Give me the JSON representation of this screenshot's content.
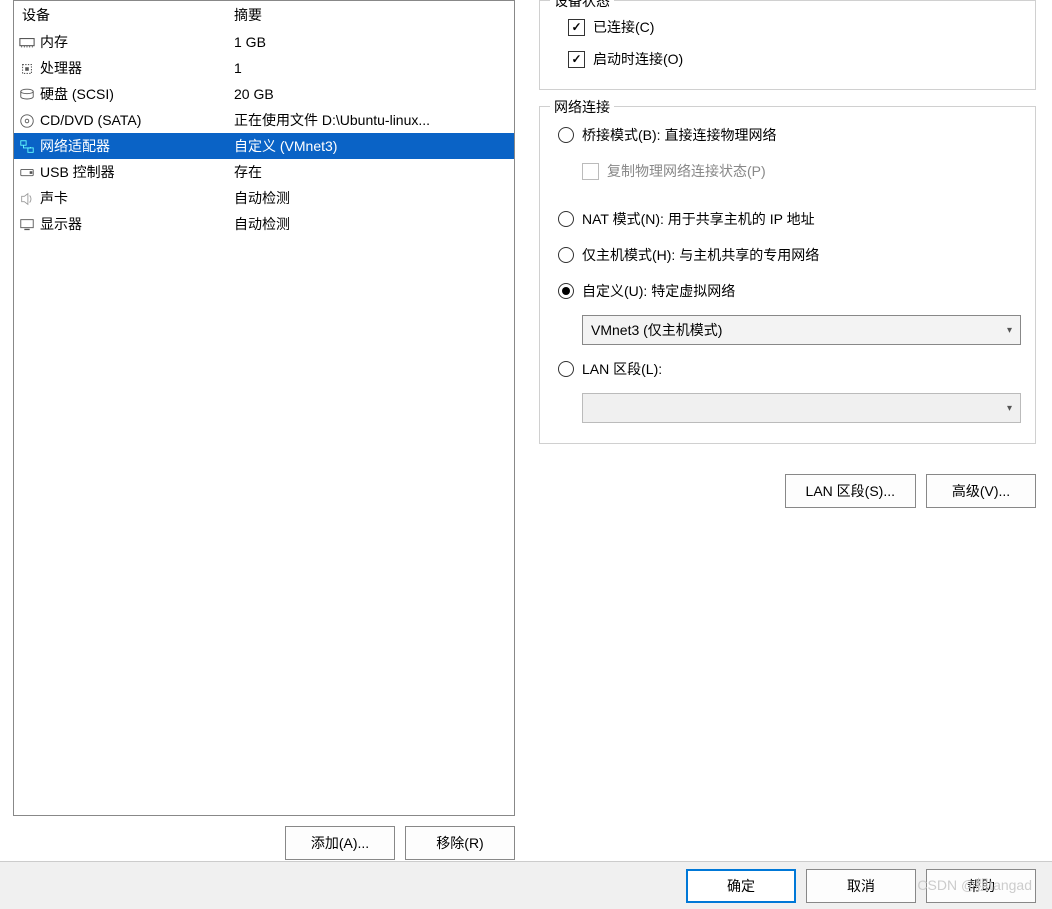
{
  "device_list": {
    "header_device": "设备",
    "header_summary": "摘要",
    "rows": [
      {
        "icon": "memory",
        "name": "内存",
        "summary": "1 GB",
        "selected": false
      },
      {
        "icon": "cpu",
        "name": "处理器",
        "summary": "1",
        "selected": false
      },
      {
        "icon": "disk",
        "name": "硬盘 (SCSI)",
        "summary": "20 GB",
        "selected": false
      },
      {
        "icon": "cd",
        "name": "CD/DVD (SATA)",
        "summary": "正在使用文件 D:\\Ubuntu-linux...",
        "selected": false
      },
      {
        "icon": "network",
        "name": "网络适配器",
        "summary": "自定义 (VMnet3)",
        "selected": true
      },
      {
        "icon": "usb",
        "name": "USB 控制器",
        "summary": "存在",
        "selected": false
      },
      {
        "icon": "sound",
        "name": "声卡",
        "summary": "自动检测",
        "selected": false
      },
      {
        "icon": "display",
        "name": "显示器",
        "summary": "自动检测",
        "selected": false
      }
    ]
  },
  "left_buttons": {
    "add": "添加(A)...",
    "remove": "移除(R)"
  },
  "device_status": {
    "title": "设备状态",
    "connected": {
      "label": "已连接(C)",
      "checked": true
    },
    "connect_at_power": {
      "label": "启动时连接(O)",
      "checked": true
    }
  },
  "network_connection": {
    "title": "网络连接",
    "bridged": {
      "label": "桥接模式(B): 直接连接物理网络",
      "selected": false
    },
    "replicate": {
      "label": "复制物理网络连接状态(P)",
      "checked": false,
      "disabled": true
    },
    "nat": {
      "label": "NAT 模式(N): 用于共享主机的 IP 地址",
      "selected": false
    },
    "hostonly": {
      "label": "仅主机模式(H): 与主机共享的专用网络",
      "selected": false
    },
    "custom": {
      "label": "自定义(U): 特定虚拟网络",
      "selected": true
    },
    "custom_select": "VMnet3 (仅主机模式)",
    "lan_segment": {
      "label": "LAN 区段(L):",
      "selected": false
    },
    "lan_select": ""
  },
  "right_buttons": {
    "lan_segments": "LAN 区段(S)...",
    "advanced": "高级(V)..."
  },
  "bottom_buttons": {
    "ok": "确定",
    "cancel": "取消",
    "help": "帮助"
  },
  "watermark": "CSDN @粗tangad",
  "icons": {
    "memory": "<rect x='1' y='4' width='16' height='8' fill='none' stroke='#555' stroke-width='1.2'/><line x1='3' y1='12' x2='3' y2='14' stroke='#555'/><line x1='6' y1='12' x2='6' y2='14' stroke='#555'/><line x1='9' y1='12' x2='9' y2='14' stroke='#555'/><line x1='12' y1='12' x2='12' y2='14' stroke='#555'/><line x1='15' y1='12' x2='15' y2='14' stroke='#555'/>",
    "cpu": "<rect x='4' y='4' width='10' height='10' fill='none' stroke='#555' stroke-width='1.2' stroke-dasharray='1.5,1.5'/><rect x='7' y='7' width='4' height='4' fill='#555'/>",
    "disk": "<ellipse cx='9' cy='5' rx='7' ry='2.5' fill='none' stroke='#555'/><path d='M2 5 v6 a7 2.5 0 0 0 14 0 v-6' fill='none' stroke='#555'/>",
    "cd": "<circle cx='9' cy='9' r='7' fill='none' stroke='#555'/><circle cx='9' cy='9' r='2' fill='none' stroke='#555'/>",
    "network": "<rect x='2' y='2' width='6' height='5' fill='none' stroke='#3a8'/><rect x='10' y='10' width='6' height='5' fill='none' stroke='#3a8'/><path d='M5 7 v3 h8 v-1' fill='none' stroke='#3a8'/>",
    "usb": "<rect x='2' y='5' width='14' height='7' rx='1' fill='none' stroke='#555'/><rect x='12' y='7' width='3' height='3' fill='#555'/>",
    "sound": "<path d='M3 6 h3 l4 -3 v12 l-4 -3 h-3 z' fill='none' stroke='#999'/><path d='M12 5 q3 4 0 8' fill='none' stroke='#999'/>",
    "display": "<rect x='2' y='3' width='14' height='9' fill='none' stroke='#555'/><line x1='6' y1='14' x2='12' y2='14' stroke='#555' stroke-width='1.5'/>"
  }
}
